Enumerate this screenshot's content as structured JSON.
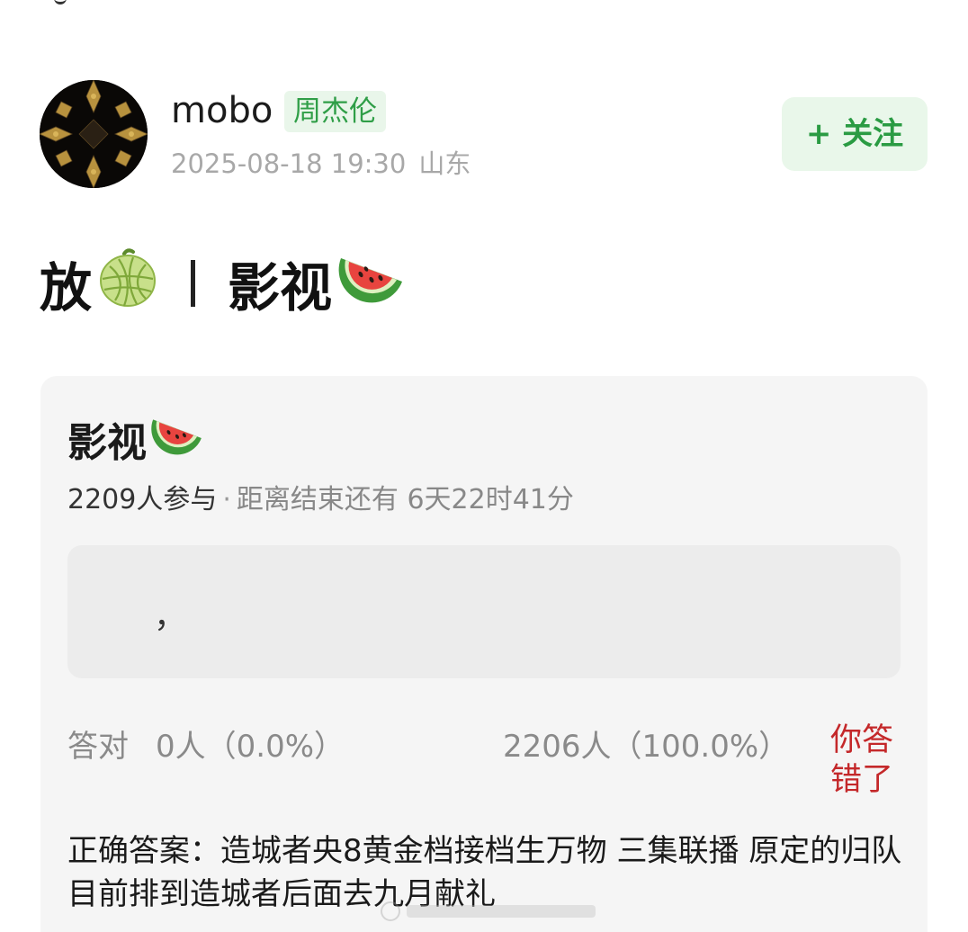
{
  "header": {
    "username": "mobo",
    "tag": "周杰伦",
    "datetime": "2025-08-18 19:30",
    "location": "山东",
    "follow_label": "+ 关注"
  },
  "post": {
    "title_part1": "放",
    "title_separator": "|",
    "title_part2": "影视"
  },
  "quiz": {
    "title": "影视",
    "participants": "2209人参与",
    "dot": "·",
    "remaining": "距离结束还有 6天22时41分",
    "option_text": "，",
    "correct_label": "答对",
    "correct_value": "0人（0.0%）",
    "other_value": "2206人（100.0%）",
    "status": "你答错了",
    "answer_text": "正确答案：造城者央8黄金档接档生万物 三集联播 原定的归队目前排到造城者后面去九月献礼"
  },
  "icons": {
    "melon": "melon-emoji",
    "watermelon": "watermelon-emoji"
  },
  "colors": {
    "accent_green": "#2a9b43",
    "tag_bg": "#e9f6ea",
    "error_red": "#c4282a",
    "card_bg": "#f5f5f5"
  }
}
